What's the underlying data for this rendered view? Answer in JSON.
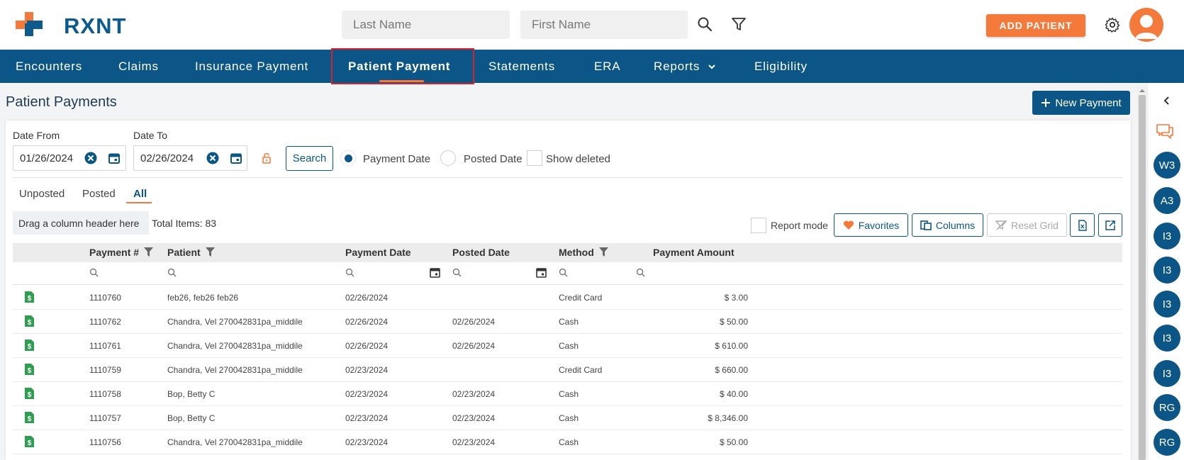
{
  "app": {
    "logo_text": "RXNT"
  },
  "header": {
    "last_name_placeholder": "Last Name",
    "first_name_placeholder": "First Name",
    "add_patient_label": "ADD PATIENT"
  },
  "nav": {
    "items": [
      {
        "label": "Encounters"
      },
      {
        "label": "Claims"
      },
      {
        "label": "Insurance Payment"
      },
      {
        "label": "Patient Payment",
        "active": true
      },
      {
        "label": "Statements"
      },
      {
        "label": "ERA"
      },
      {
        "label": "Reports"
      },
      {
        "label": "Eligibility"
      }
    ]
  },
  "page": {
    "title": "Patient Payments",
    "new_payment_label": "New Payment"
  },
  "filters": {
    "date_from_label": "Date From",
    "date_from_value": "01/26/2024",
    "date_to_label": "Date To",
    "date_to_value": "02/26/2024",
    "search_label": "Search",
    "payment_date_label": "Payment Date",
    "posted_date_label": "Posted Date",
    "show_deleted_label": "Show deleted",
    "selected_radio": "Payment Date"
  },
  "tabs": [
    {
      "label": "Unposted"
    },
    {
      "label": "Posted"
    },
    {
      "label": "All",
      "active": true
    }
  ],
  "toolbar": {
    "drag_hint": "Drag a column header here",
    "total_items": "Total Items: 83",
    "report_mode_label": "Report mode",
    "favorites_label": "Favorites",
    "columns_label": "Columns",
    "reset_grid_label": "Reset Grid"
  },
  "grid": {
    "columns": [
      "Payment #",
      "Patient",
      "Payment Date",
      "Posted Date",
      "Method",
      "Payment Amount"
    ],
    "rows": [
      {
        "payment_no": "1110760",
        "patient": "feb26, feb26 feb26",
        "payment_date": "02/26/2024",
        "posted_date": "",
        "method": "Credit Card",
        "amount": "$ 3.00"
      },
      {
        "payment_no": "1110762",
        "patient": "Chandra, Vel 270042831pa_middile",
        "payment_date": "02/26/2024",
        "posted_date": "02/26/2024",
        "method": "Cash",
        "amount": "$ 50.00"
      },
      {
        "payment_no": "1110761",
        "patient": "Chandra, Vel 270042831pa_middile",
        "payment_date": "02/26/2024",
        "posted_date": "02/26/2024",
        "method": "Cash",
        "amount": "$ 610.00"
      },
      {
        "payment_no": "1110759",
        "patient": "Chandra, Vel 270042831pa_middile",
        "payment_date": "02/23/2024",
        "posted_date": "",
        "method": "Credit Card",
        "amount": "$ 660.00"
      },
      {
        "payment_no": "1110758",
        "patient": "Bop, Betty C",
        "payment_date": "02/23/2024",
        "posted_date": "02/23/2024",
        "method": "Cash",
        "amount": "$ 40.00"
      },
      {
        "payment_no": "1110757",
        "patient": "Bop, Betty C",
        "payment_date": "02/23/2024",
        "posted_date": "02/23/2024",
        "method": "Cash",
        "amount": "$ 8,346.00"
      },
      {
        "payment_no": "1110756",
        "patient": "Chandra, Vel 270042831pa_middile",
        "payment_date": "02/23/2024",
        "posted_date": "02/23/2024",
        "method": "Cash",
        "amount": "$ 50.00"
      }
    ]
  },
  "rail": {
    "bubbles": [
      "W3",
      "A3",
      "I3",
      "I3",
      "I3",
      "I3",
      "I3",
      "RG",
      "RG"
    ]
  },
  "colors": {
    "brand_blue": "#0b5587",
    "accent_orange": "#f47a3c",
    "highlight_red": "#d9212c",
    "doc_green": "#2e9e4f"
  }
}
